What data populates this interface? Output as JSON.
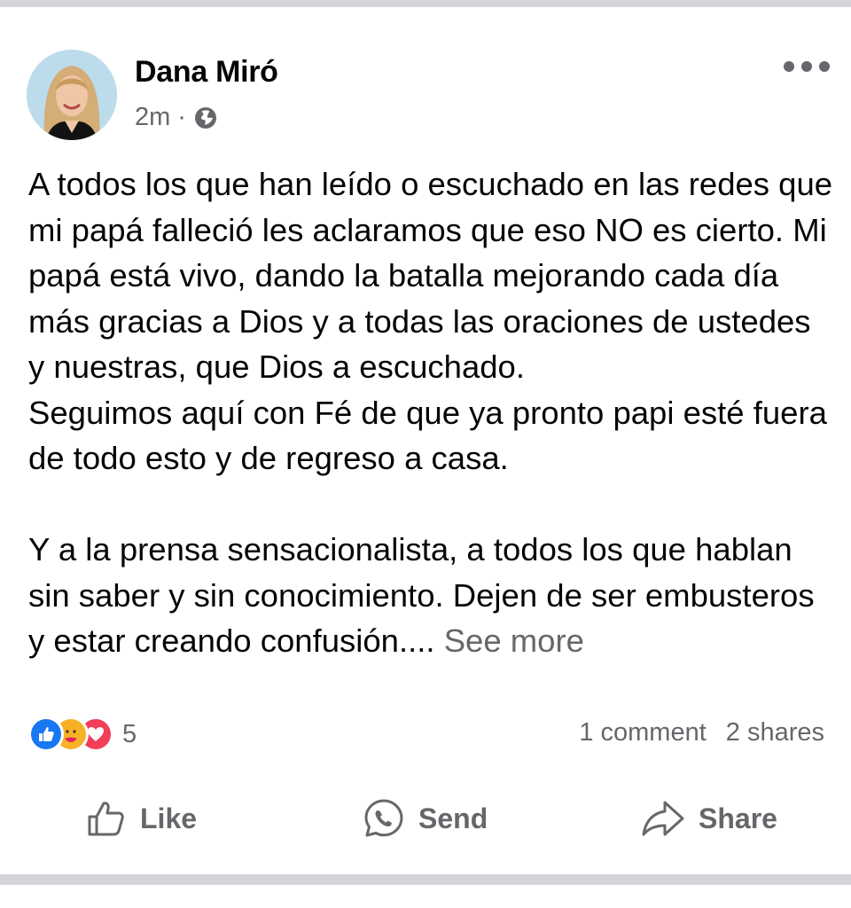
{
  "post": {
    "author": "Dana Miró",
    "time": "2m",
    "separator": "·",
    "privacy_icon": "globe-icon",
    "menu_icon": "more-options-icon",
    "paragraphs": [
      "A todos los que han leído o escuchado en las redes que mi papá falleció les aclaramos que eso NO es cierto. Mi papá está vivo, dando la batalla mejorando cada día más gracias a Dios y a todas las oraciones de ustedes y nuestras, que Dios a escuchado.",
      "Seguimos aquí con Fé de que ya pronto papi esté fuera de todo esto y de regreso a casa.",
      "Y a la prensa sensacionalista, a todos los que hablan sin saber y sin conocimiento. Dejen de ser embusteros y estar creando confusión...."
    ],
    "see_more": "See more"
  },
  "engagement": {
    "reactions": [
      "like-reaction-icon",
      "care-reaction-icon",
      "love-reaction-icon"
    ],
    "reaction_count": "5",
    "comments": "1 comment",
    "shares": "2 shares"
  },
  "actions": {
    "like": "Like",
    "send": "Send",
    "share": "Share"
  },
  "colors": {
    "text_primary": "#050505",
    "text_secondary": "#65676b",
    "like_blue": "#1877f2",
    "care_yellow": "#f7b125",
    "love_red": "#f33e58",
    "divider": "#d3d5d9"
  }
}
